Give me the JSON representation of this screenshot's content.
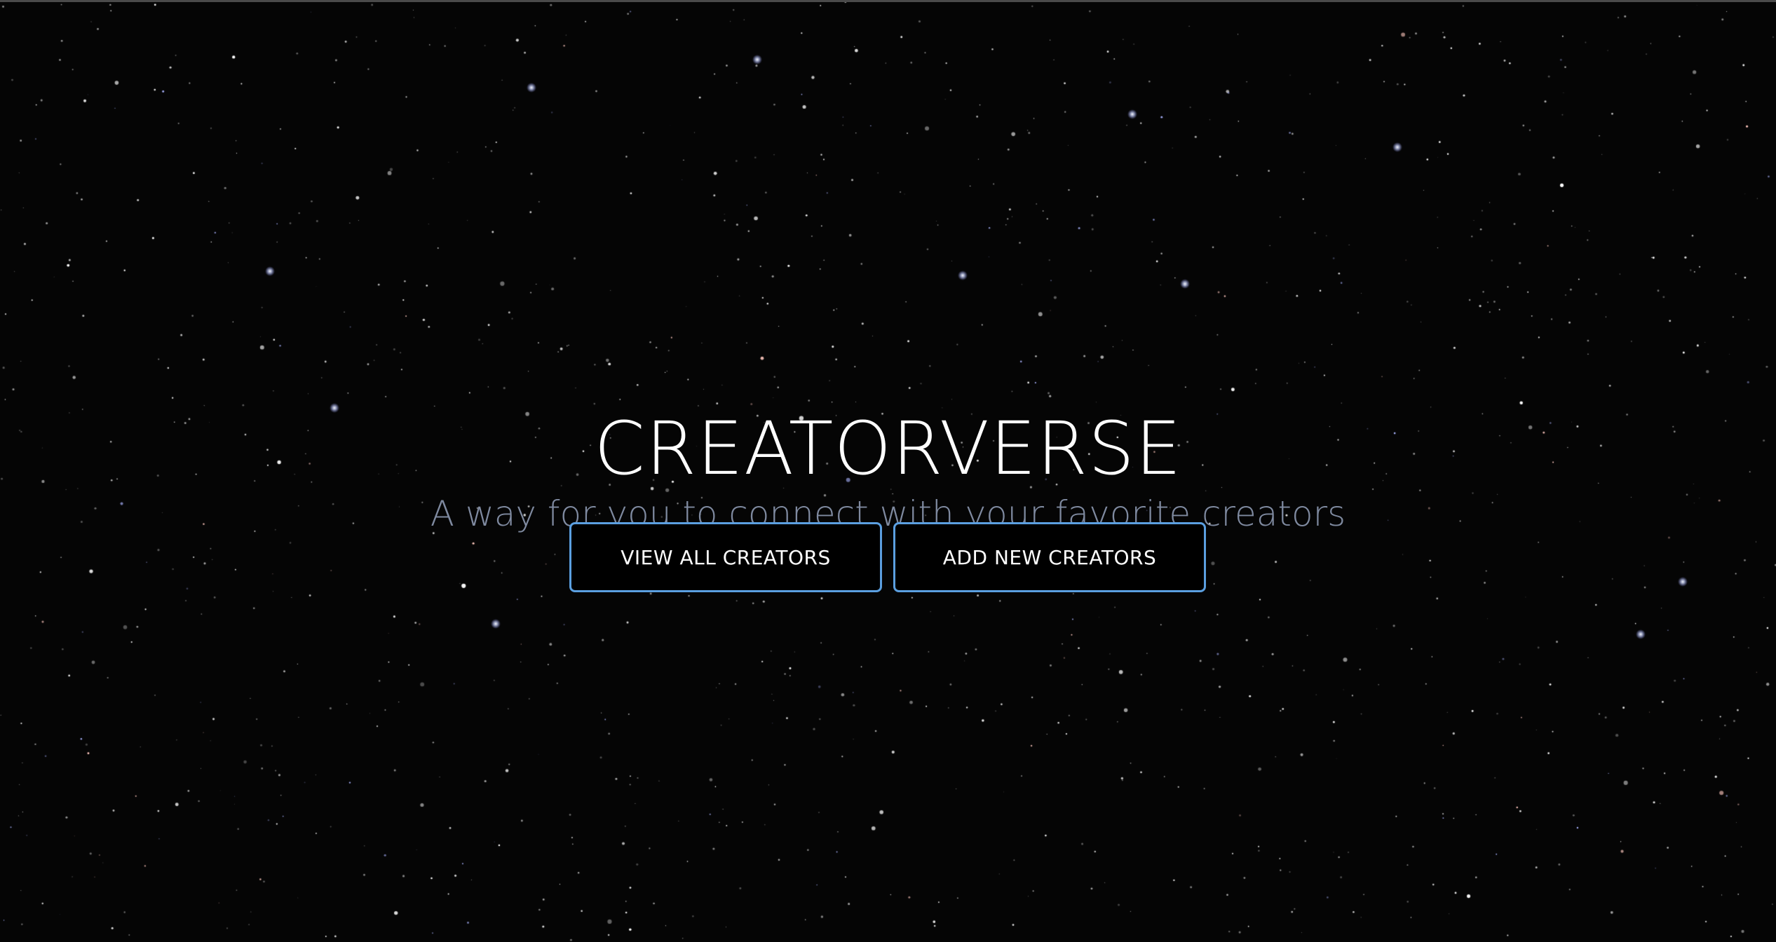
{
  "hero": {
    "title": "CREATORVERSE",
    "subtitle": "A way for you to connect with your favorite creators"
  },
  "actions": {
    "view_all_label": "VIEW ALL CREATORS",
    "add_new_label": "ADD NEW CREATORS"
  },
  "colors": {
    "background": "#050505",
    "button_border": "#5b9fe0",
    "subtitle": "#7f8aa0",
    "title": "#ffffff"
  }
}
